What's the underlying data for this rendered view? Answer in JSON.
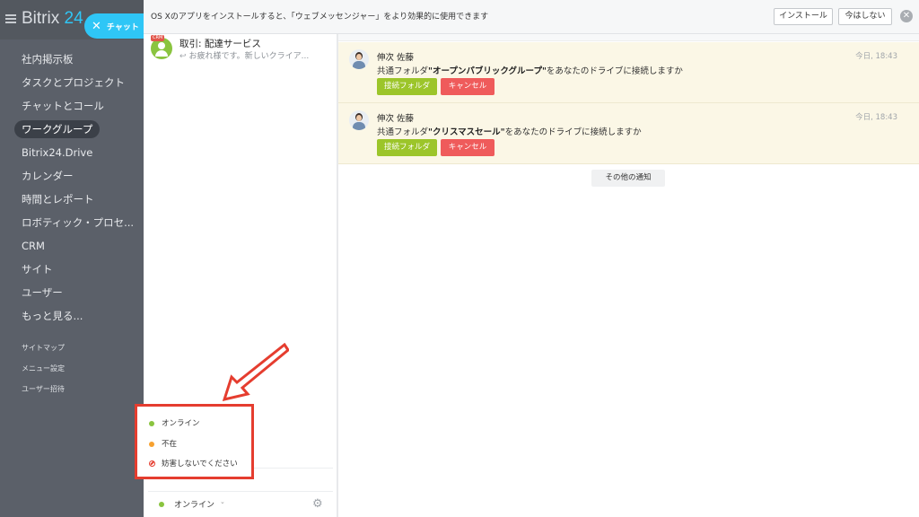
{
  "logo": {
    "name": "Bitrix",
    "number": "24"
  },
  "chat_button": {
    "label": "チャット"
  },
  "sidebar": {
    "items": [
      {
        "label": "社内掲示板",
        "active": false
      },
      {
        "label": "タスクとプロジェクト",
        "active": false
      },
      {
        "label": "チャットとコール",
        "active": false
      },
      {
        "label": "ワークグループ",
        "active": true
      },
      {
        "label": "Bitrix24.Drive",
        "active": false
      },
      {
        "label": "カレンダー",
        "active": false
      },
      {
        "label": "時間とレポート",
        "active": false
      },
      {
        "label": "ロボティック・プロセ...",
        "active": false
      },
      {
        "label": "CRM",
        "active": false
      },
      {
        "label": "サイト",
        "active": false
      },
      {
        "label": "ユーザー",
        "active": false
      },
      {
        "label": "もっと見る...",
        "active": false
      }
    ],
    "links": [
      "サイトマップ",
      "メニュー設定",
      "ユーザー招待"
    ]
  },
  "banner": {
    "text": "OS Xのアプリをインストールすると、「ウェブメッセンジャー」をより効果的に使用できます",
    "install_label": "インストール",
    "later_label": "今はしない"
  },
  "recent_chat": {
    "badge": "CRM",
    "title": "取引: 配達サービス",
    "message": "お疲れ様です。新しいクライア..."
  },
  "notifications": [
    {
      "name": "伸次 佐藤",
      "time": "今日, 18:43",
      "prefix": "共通フォルダ",
      "folder": "\"オープンパブリックグループ\"",
      "suffix": "をあなたのドライブに接続しますか",
      "accept": "接続フォルダ",
      "cancel": "キャンセル"
    },
    {
      "name": "伸次 佐藤",
      "time": "今日, 18:43",
      "prefix": "共通フォルダ",
      "folder": "\"クリスマスセール\"",
      "suffix": "をあなたのドライブに接続しますか",
      "accept": "接続フォルダ",
      "cancel": "キャンセル"
    }
  ],
  "more_notifications": "その他の通知",
  "status_menu": {
    "options": [
      {
        "label": "オンライン",
        "color": "#8ac43f"
      },
      {
        "label": "不在",
        "color": "#f7a12f"
      },
      {
        "label": "妨害しないでください",
        "color": "#e53d2f"
      }
    ]
  },
  "current_status": {
    "label": "オンライン",
    "color": "#8ac43f"
  },
  "colors": {
    "accent": "#2fc6f6",
    "highlight": "#e53d2f",
    "accept": "#9cc52a",
    "cancel": "#ef5b5b"
  }
}
